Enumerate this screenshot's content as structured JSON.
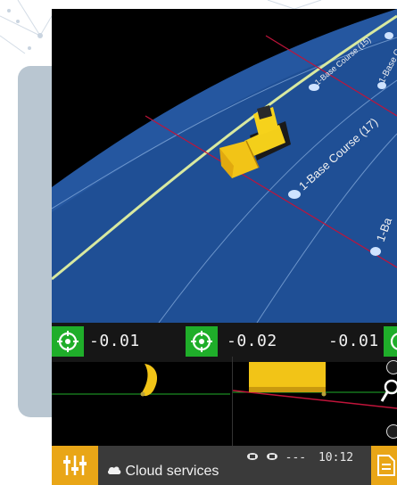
{
  "road_labels": [
    "1-Base Course (15)",
    "1-Base Course (17)",
    "1-Base C",
    "1-Ba"
  ],
  "sensors": [
    {
      "value": "-0.01"
    },
    {
      "value": "-0.02"
    },
    {
      "value": "-0.01"
    }
  ],
  "status": {
    "time": "10:12",
    "signal": "---"
  },
  "cloud_label": "Cloud services",
  "icons": {
    "target": "crosshair-target-icon",
    "menu": "sliders-menu-icon",
    "zoom": "magnifier-icon",
    "cloud": "cloud-icon",
    "doc": "document-icon"
  },
  "colors": {
    "surface": "#1f4f95",
    "accent": "#e9a617",
    "target_green": "#1fae2a",
    "design_line": "#d8e9a0",
    "reference_line": "#c0143a"
  }
}
